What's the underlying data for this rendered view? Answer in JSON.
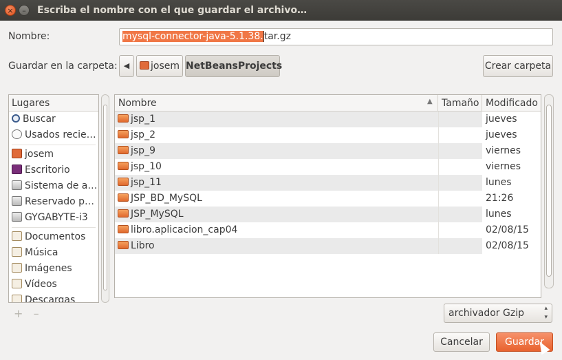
{
  "window": {
    "title": "Escriba el nombre con el que guardar el archivo…",
    "close_glyph": "×",
    "min_glyph": "–"
  },
  "name_field": {
    "label": "Nombre:",
    "value_selected": "mysql-connector-java-5.1.38.",
    "value_rest": "tar.gz"
  },
  "folder": {
    "label": "Guardar en la carpeta:",
    "back_glyph": "◀",
    "crumbs": [
      "josem",
      "NetBeansProjects"
    ],
    "new_folder_label": "Crear carpeta"
  },
  "places": {
    "header": "Lugares",
    "items": [
      {
        "label": "Buscar",
        "icon": "search-icon"
      },
      {
        "label": "Usados recie…",
        "icon": "recent-icon"
      },
      {
        "label": "josem",
        "icon": "home-folder-icon"
      },
      {
        "label": "Escritorio",
        "icon": "desktop-icon"
      },
      {
        "label": "Sistema de a…",
        "icon": "drive-icon"
      },
      {
        "label": "Reservado p…",
        "icon": "drive-icon"
      },
      {
        "label": "GYGABYTE-i3",
        "icon": "drive-icon"
      },
      {
        "label": "Documentos",
        "icon": "documents-icon"
      },
      {
        "label": "Música",
        "icon": "music-icon"
      },
      {
        "label": "Imágenes",
        "icon": "pictures-icon"
      },
      {
        "label": "Vídeos",
        "icon": "videos-icon"
      },
      {
        "label": "Descargas",
        "icon": "downloads-icon"
      }
    ],
    "add_glyph": "+",
    "remove_glyph": "–"
  },
  "files": {
    "columns": {
      "name": "Nombre",
      "size": "Tamaño",
      "modified": "Modificado"
    },
    "sort_glyph": "▲",
    "rows": [
      {
        "name": "jsp_1",
        "size": "",
        "modified": "jueves"
      },
      {
        "name": "jsp_2",
        "size": "",
        "modified": "jueves"
      },
      {
        "name": "jsp_9",
        "size": "",
        "modified": "viernes"
      },
      {
        "name": "jsp_10",
        "size": "",
        "modified": "viernes"
      },
      {
        "name": "jsp_11",
        "size": "",
        "modified": "lunes"
      },
      {
        "name": "JSP_BD_MySQL",
        "size": "",
        "modified": "21:26"
      },
      {
        "name": "JSP_MySQL",
        "size": "",
        "modified": "lunes"
      },
      {
        "name": "libro.aplicacion_cap04",
        "size": "",
        "modified": "02/08/15"
      },
      {
        "name": "Libro",
        "size": "",
        "modified": "02/08/15"
      }
    ]
  },
  "filter": {
    "value": "archivador Gzip",
    "up_glyph": "▴",
    "down_glyph": "▾"
  },
  "actions": {
    "cancel_label": "Cancelar",
    "save_label": "Guardar"
  },
  "colors": {
    "accent": "#e8622e",
    "titlebar": "#3c3b37",
    "selection": "#f07746"
  }
}
